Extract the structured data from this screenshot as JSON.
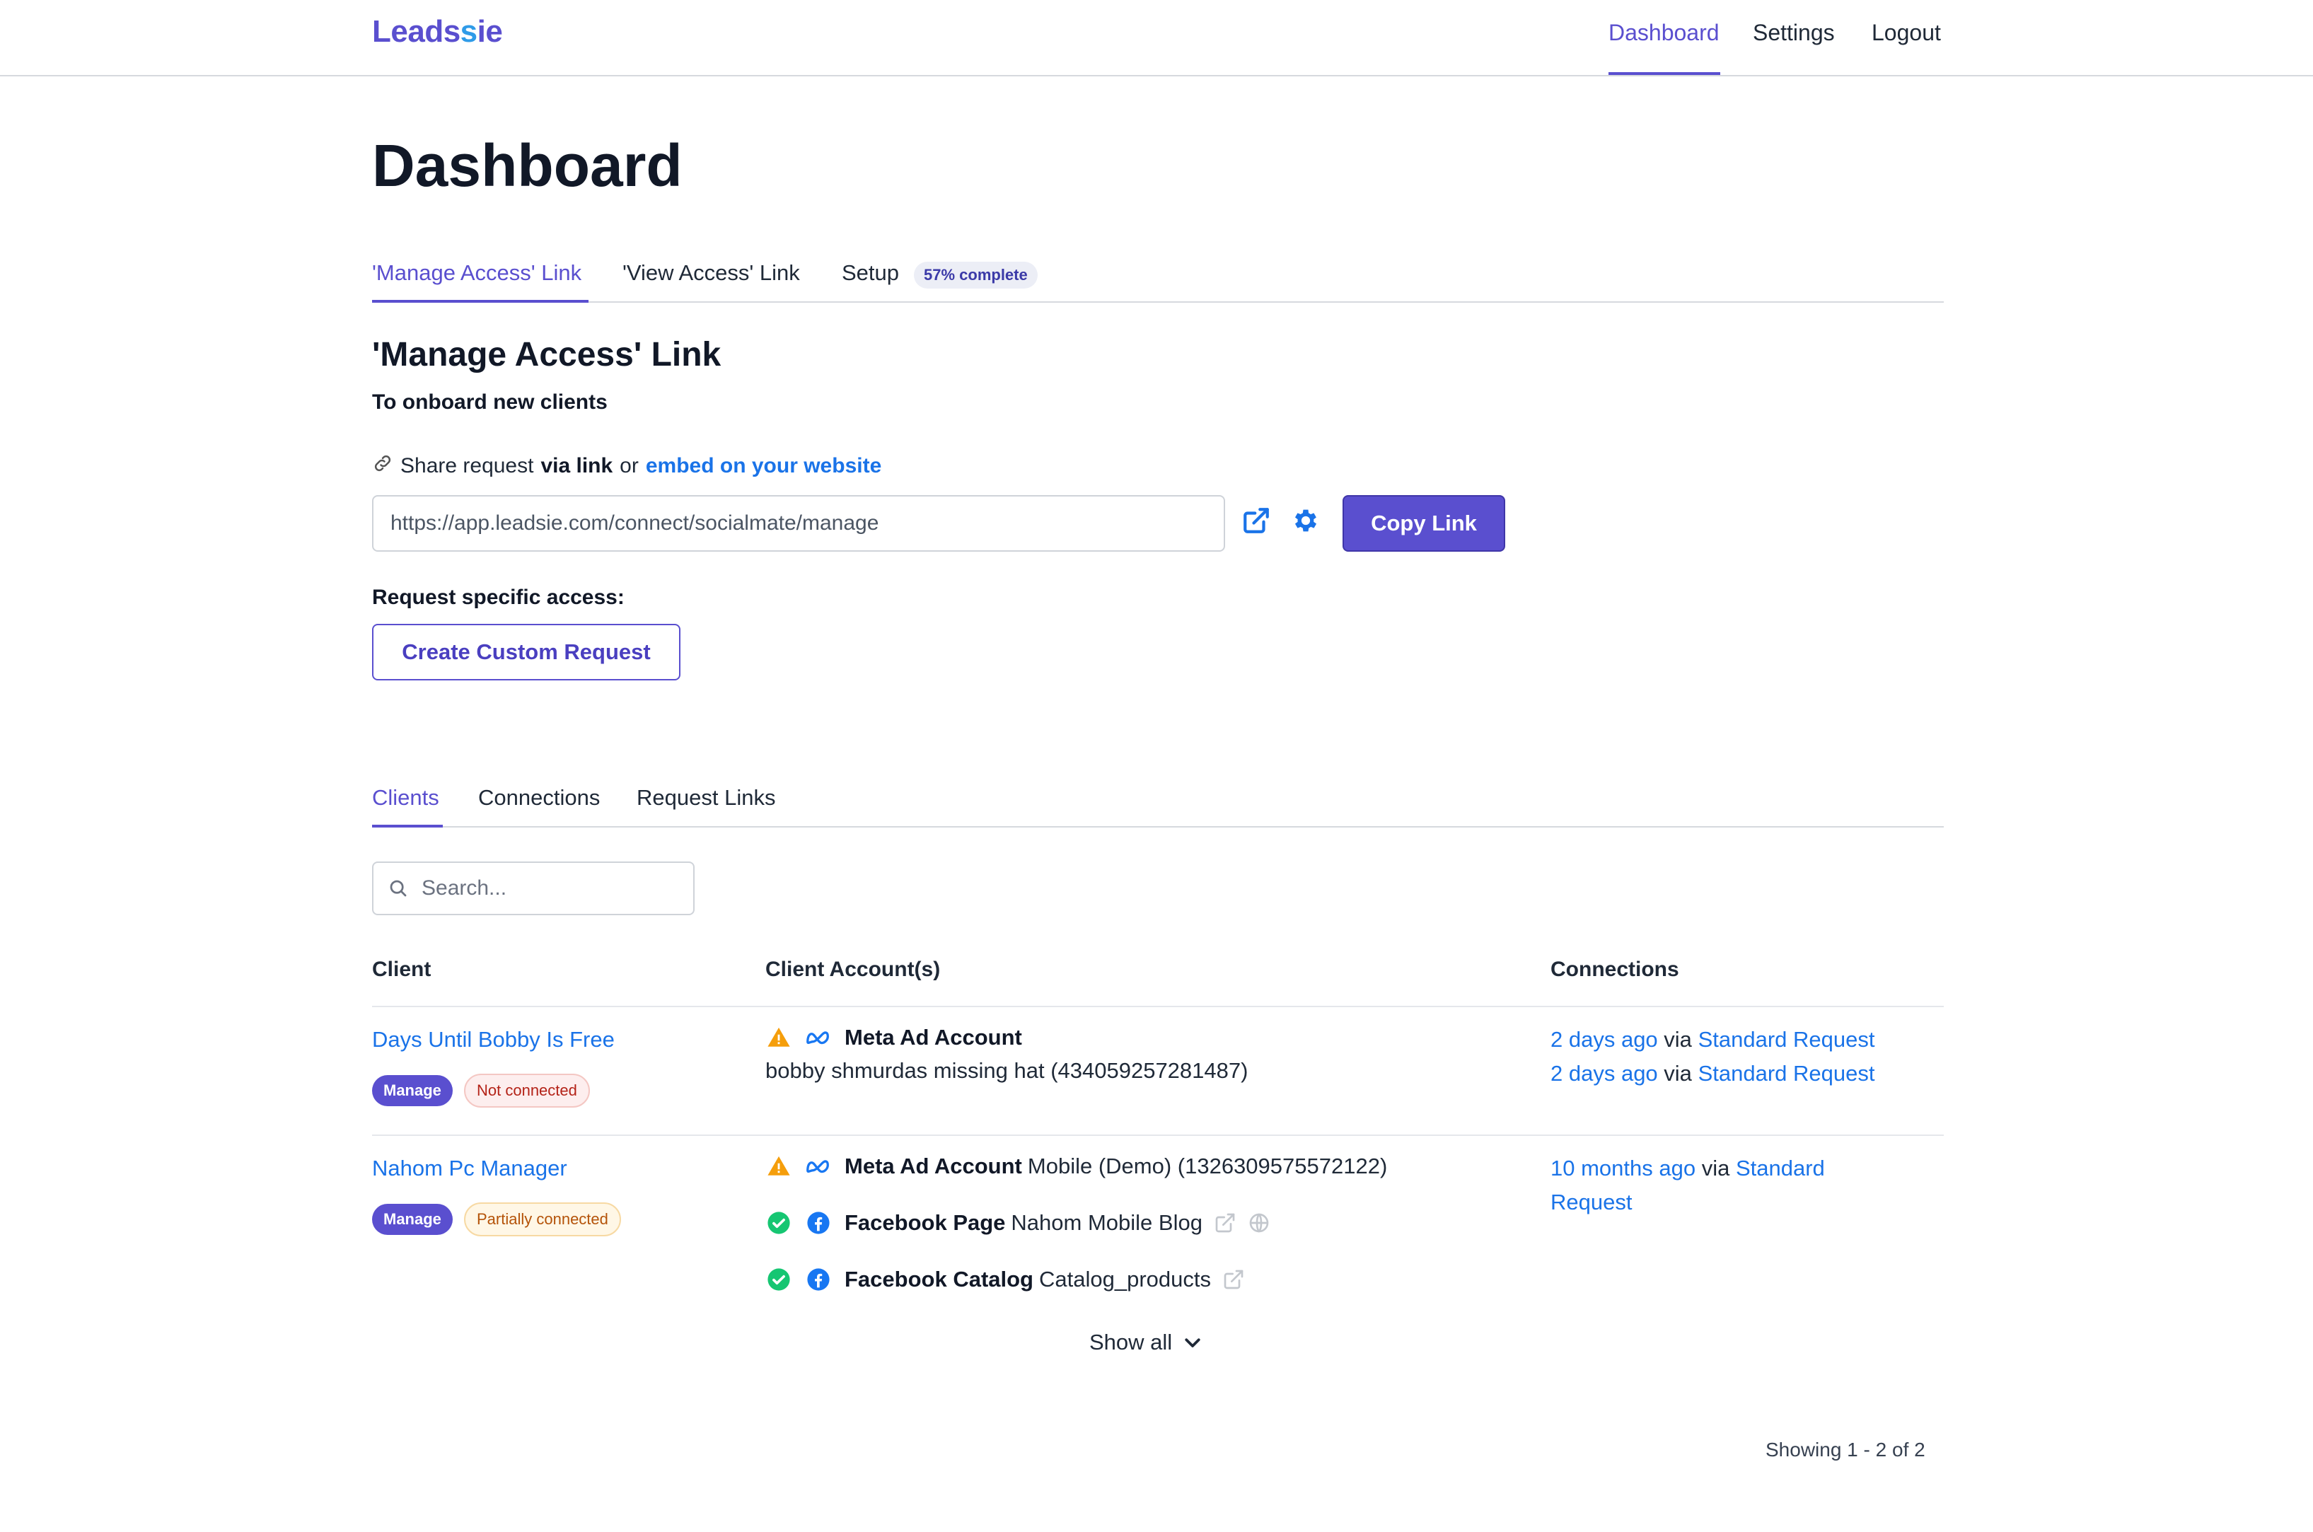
{
  "nav": {
    "logo_main": "Leads",
    "logo_accent": "i",
    "logo_end": "e",
    "links": [
      "Dashboard",
      "Settings",
      "Logout"
    ]
  },
  "page": {
    "title": "Dashboard"
  },
  "top_tabs": {
    "manage": "'Manage Access' Link",
    "view": "'View Access' Link",
    "setup": "Setup",
    "setup_badge": "57% complete"
  },
  "manage_section": {
    "title": "'Manage Access' Link",
    "subtitle": "To onboard new clients",
    "share_prefix": "Share request",
    "share_via": "via link",
    "share_or": "or",
    "share_embed": "embed on your website",
    "url": "https://app.leadsie.com/connect/socialmate/manage",
    "copy_label": "Copy Link",
    "request_label": "Request specific access:",
    "custom_label": "Create Custom Request"
  },
  "bottom_tabs": [
    "Clients",
    "Connections",
    "Request Links"
  ],
  "search": {
    "placeholder": "Search..."
  },
  "table": {
    "headers": [
      "Client",
      "Client Account(s)",
      "Connections"
    ],
    "rows": [
      {
        "client": "Days Until Bobby Is Free",
        "badge_manage": "Manage",
        "badge_status": "Not connected",
        "accounts": [
          {
            "type": "Meta Ad Account",
            "name": ""
          },
          {
            "type": "",
            "name": "bobby shmurdas missing hat (434059257281487)"
          }
        ],
        "connections": [
          {
            "when": "2 days ago",
            "via": "via",
            "source": "Standard Request"
          },
          {
            "when": "2 days ago",
            "via": "via",
            "source": "Standard Request"
          }
        ]
      },
      {
        "client": "Nahom Pc Manager",
        "badge_manage": "Manage",
        "badge_status": "Partially connected",
        "accounts": [
          {
            "type": "Meta Ad Account",
            "name": "Mobile (Demo) (1326309575572122)"
          },
          {
            "type": "Facebook Page",
            "name": "Nahom Mobile Blog"
          },
          {
            "type": "Facebook Catalog",
            "name": "Catalog_products"
          }
        ],
        "connections": [
          {
            "when": "10 months ago",
            "via": "via",
            "source": "Standard",
            "source_cont": "Request"
          }
        ]
      }
    ]
  },
  "show_all": "Show all",
  "pagination": "Showing 1 - 2 of 2",
  "colors": {
    "brand": "#5a4fcf",
    "link": "#1a73e8",
    "warning": "#f59e0b",
    "success": "#16c672",
    "facebook": "#1877f2"
  }
}
